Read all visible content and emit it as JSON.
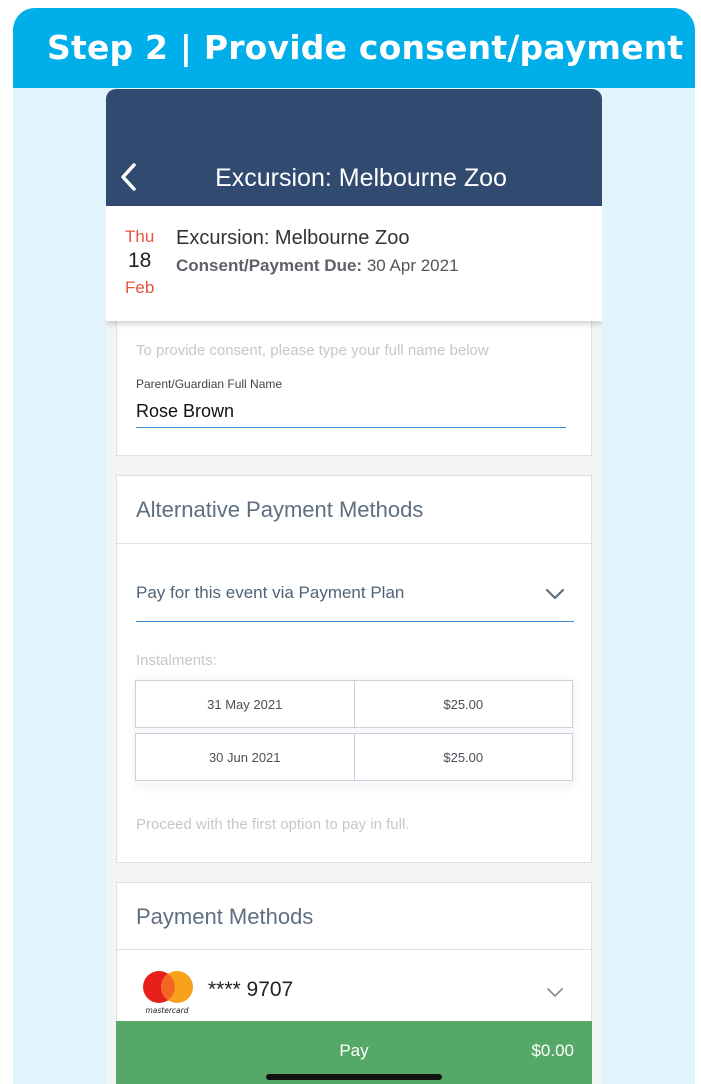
{
  "banner": {
    "title": "Step 2 | Provide consent/payment"
  },
  "header": {
    "title": "Excursion: Melbourne Zoo"
  },
  "event": {
    "day_of_week": "Thu",
    "day": "18",
    "month": "Feb",
    "title": "Excursion: Melbourne Zoo",
    "due_label": "Consent/Payment Due:",
    "due_date": "30 Apr 2021"
  },
  "consent": {
    "hint": "To provide consent, please type your full name below",
    "field_label": "Parent/Guardian Full Name",
    "field_value": "Rose Brown"
  },
  "alternative": {
    "heading": "Alternative Payment Methods",
    "selected_option": "Pay for this event via Payment Plan",
    "instalments_label": "Instalments:",
    "instalments": [
      {
        "date": "31 May 2021",
        "amount": "$25.00"
      },
      {
        "date": "30 Jun 2021",
        "amount": "$25.00"
      }
    ],
    "note": "Proceed with the first option to pay in full."
  },
  "payment": {
    "heading": "Payment Methods",
    "card_brand": "mastercard",
    "card_number": "**** 9707"
  },
  "pay_bar": {
    "label": "Pay",
    "amount": "$0.00"
  },
  "colors": {
    "banner": "#00aee9",
    "header": "#314a70",
    "accent_red": "#e5533c",
    "pay_green": "#56a866",
    "link_blue": "#3a8bd8"
  }
}
